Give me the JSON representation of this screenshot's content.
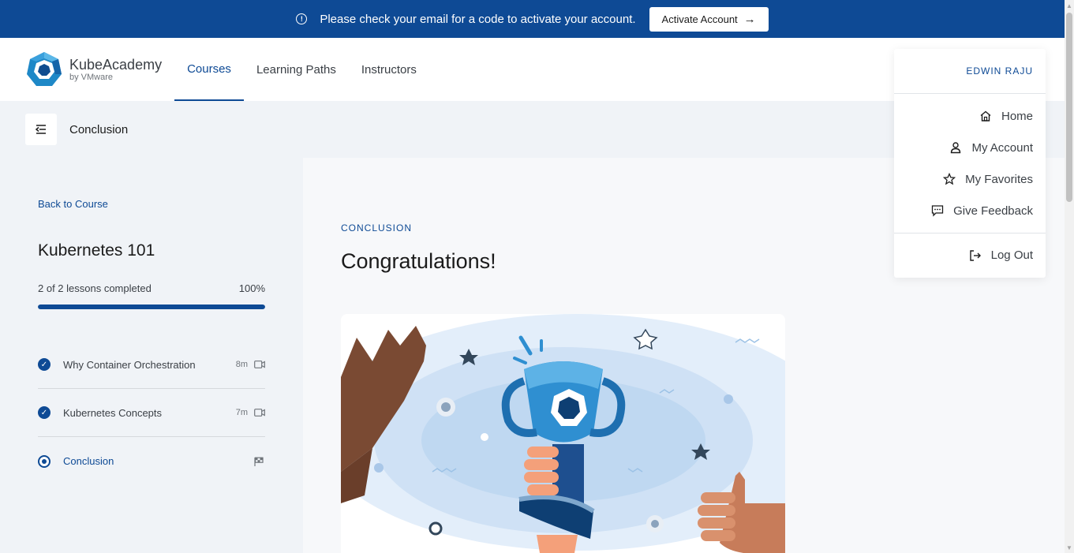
{
  "banner": {
    "message": "Please check your email for a code to activate your account.",
    "button_label": "Activate Account"
  },
  "brand": {
    "name": "KubeAcademy",
    "sub": "by VMware"
  },
  "nav": {
    "links": [
      "Courses",
      "Learning Paths",
      "Instructors"
    ],
    "active": "Courses"
  },
  "lesson_bar": {
    "title": "Conclusion"
  },
  "sidebar": {
    "back_label": "Back to Course",
    "course_title": "Kubernetes 101",
    "progress_text": "2 of 2 lessons completed",
    "progress_percent": "100%",
    "progress_value": 1.0,
    "lessons": [
      {
        "name": "Why Container Orchestration",
        "duration": "8m",
        "type": "video-icon",
        "status": "completed"
      },
      {
        "name": "Kubernetes Concepts",
        "duration": "7m",
        "type": "video-icon",
        "status": "completed"
      },
      {
        "name": "Conclusion",
        "duration": "",
        "type": "flag-icon",
        "status": "current"
      }
    ]
  },
  "main": {
    "eyebrow": "CONCLUSION",
    "heading": "Congratulations!"
  },
  "user_menu": {
    "user_name": "EDWIN RAJU",
    "items": [
      {
        "label": "Home",
        "icon": "home-icon"
      },
      {
        "label": "My Account",
        "icon": "user-icon"
      },
      {
        "label": "My Favorites",
        "icon": "star-icon"
      },
      {
        "label": "Give Feedback",
        "icon": "feedback-icon"
      }
    ],
    "logout_label": "Log Out"
  },
  "colors": {
    "brand_blue": "#0e4a95",
    "banner_bg": "#0e4a95",
    "page_bg": "#f0f3f7"
  }
}
